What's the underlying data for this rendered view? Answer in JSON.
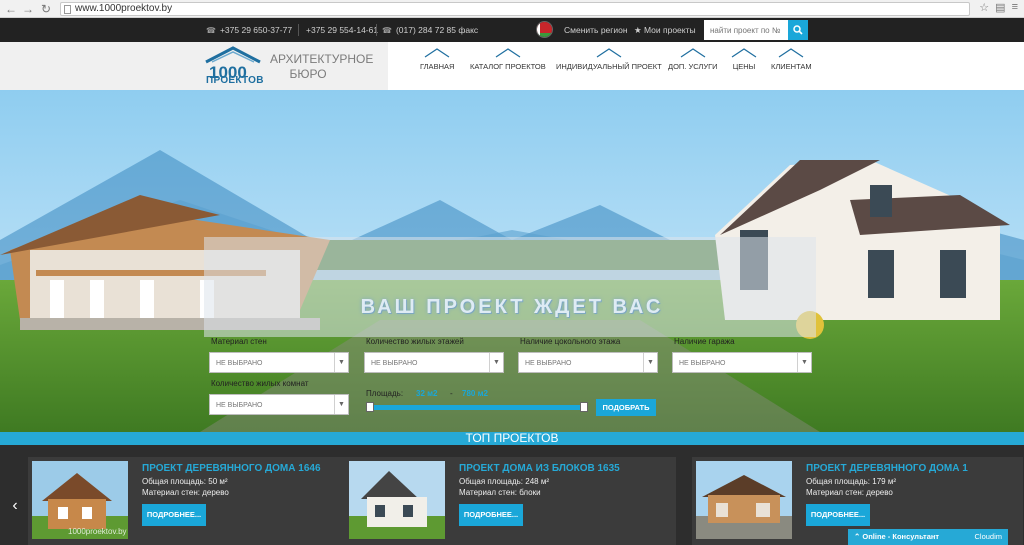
{
  "browser": {
    "url": "www.1000proektov.by"
  },
  "topbar": {
    "phones": [
      "+375 29 650-37-77",
      "+375 29 554-14-61",
      "(017) 284 72 85 факс"
    ],
    "region": "Сменить регион",
    "my_projects": "Мои проекты",
    "search_placeholder": "найти проект по №"
  },
  "header": {
    "logo_text": "ПРОЕКТОВ",
    "logo_digits": "1000",
    "bureau_line1": "АРХИТЕКТУРНОЕ",
    "bureau_line2": "БЮРО",
    "menu": [
      "ГЛАВНАЯ",
      "КАТАЛОГ ПРОЕКТОВ",
      "ИНДИВИДУАЛЬНЫЙ ПРОЕКТ",
      "ДОП. УСЛУГИ",
      "ЦЕНЫ",
      "КЛИЕНТАМ"
    ]
  },
  "hero": {
    "title": "ВАШ ПРОЕКТ ЖДЕТ ВАС"
  },
  "filter": {
    "walls_label": "Материал стен",
    "floors_label": "Количество жилых этажей",
    "basement_label": "Наличие цокольного этажа",
    "garage_label": "Наличие гаража",
    "rooms_label": "Количество жилых комнат",
    "not_selected": "НЕ ВЫБРАНО",
    "area_label": "Площадь:",
    "area_min": "32 м2",
    "area_dash": "-",
    "area_max": "780 м2",
    "submit": "ПОДОБРАТЬ"
  },
  "top": {
    "title": "ТОП ПРОЕКТОВ",
    "more": "ПОДРОБНЕЕ...",
    "watermark": "1000proektov.by",
    "cards": [
      {
        "title": "ПРОЕКТ ДЕРЕВЯННОГО ДОМА 1646",
        "area": "Общая площадь: 50 м²",
        "material": "Материал стен: дерево"
      },
      {
        "title": "ПРОЕКТ ДОМА ИЗ БЛОКОВ 1635",
        "area": "Общая площадь: 248 м²",
        "material": "Материал стен: блоки"
      },
      {
        "title": "ПРОЕКТ ДЕРЕВЯННОГО ДОМА 1",
        "area": "Общая площадь: 179 м²",
        "material": "Материал стен: дерево"
      }
    ]
  },
  "widget": {
    "label": "Online - Консультант",
    "brand": "Cloudim"
  },
  "colors": {
    "accent": "#1aa7d9",
    "dark": "#222222"
  }
}
